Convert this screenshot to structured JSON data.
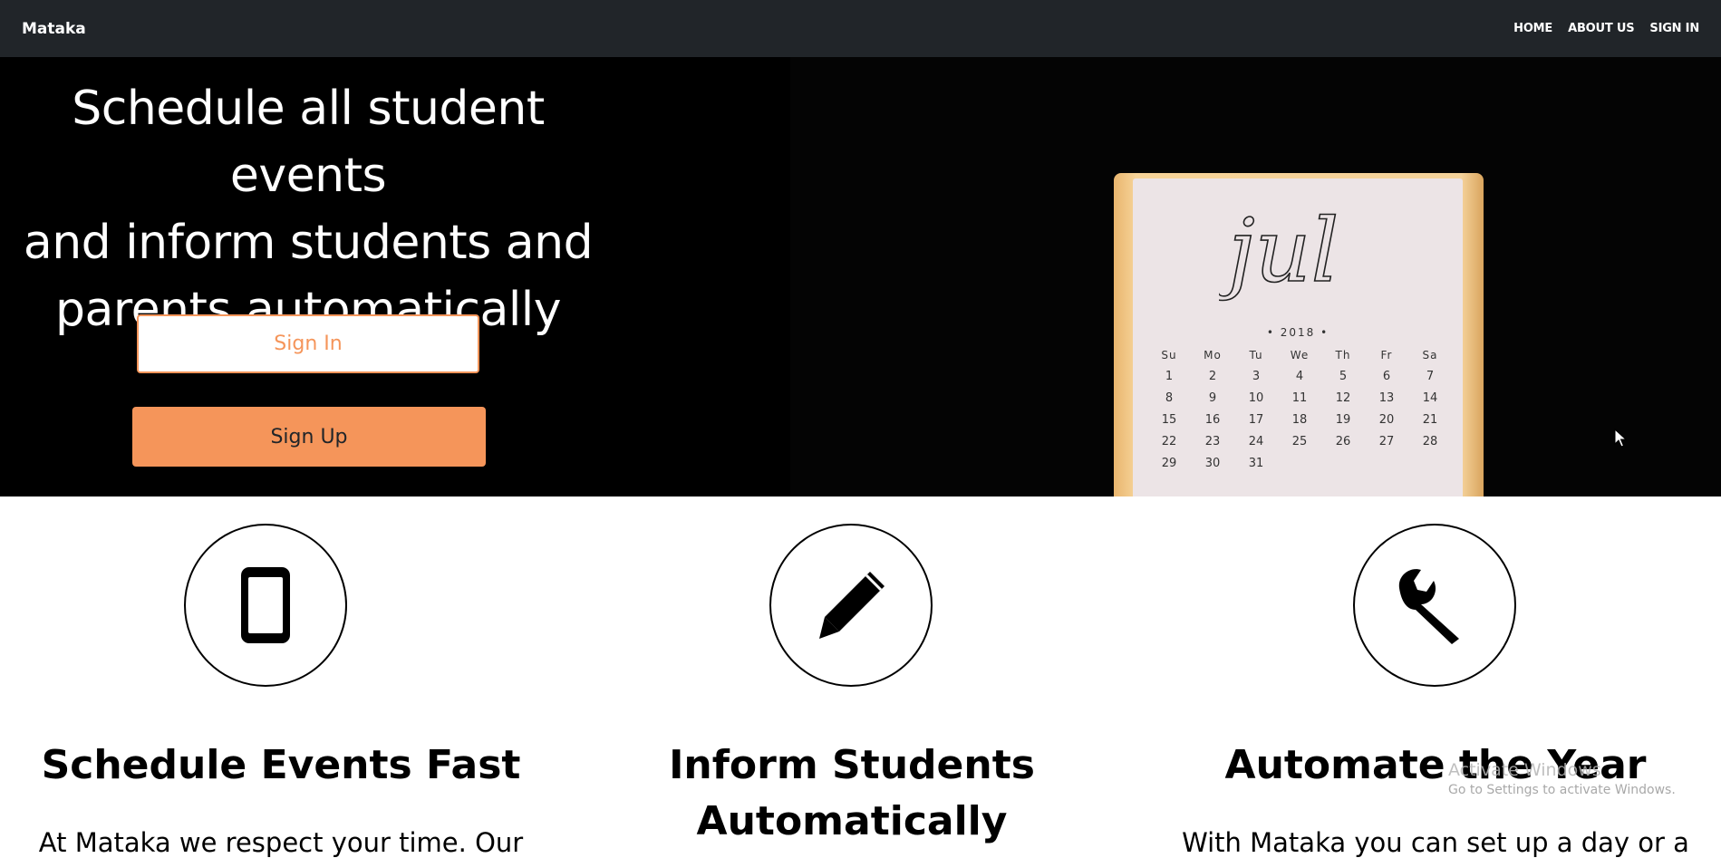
{
  "navbar": {
    "brand": "Mataka",
    "links": [
      "HOME",
      "ABOUT US",
      "SIGN IN"
    ]
  },
  "hero": {
    "title_lines": [
      "Schedule all student events",
      "and inform students and",
      "parents automatically"
    ],
    "signin_label": "Sign In",
    "signup_label": "Sign Up",
    "calendar": {
      "month": "jul",
      "year": "• 2018 •",
      "weekdays": [
        "Su",
        "Mo",
        "Tu",
        "We",
        "Th",
        "Fr",
        "Sa"
      ],
      "days": [
        "1",
        "2",
        "3",
        "4",
        "5",
        "6",
        "7",
        "8",
        "9",
        "10",
        "11",
        "12",
        "13",
        "14",
        "15",
        "16",
        "17",
        "18",
        "19",
        "20",
        "21",
        "22",
        "23",
        "24",
        "25",
        "26",
        "27",
        "28",
        "29",
        "30",
        "31"
      ]
    }
  },
  "features": [
    {
      "icon": "mobile-phone-icon",
      "title": "Schedule Events Fast",
      "text": "At Mataka we respect your time. Our"
    },
    {
      "icon": "pencil-icon",
      "title": "Inform Students Automatically",
      "text": ""
    },
    {
      "icon": "wrench-icon",
      "title": "Automate the Year",
      "text": "With Mataka you can set up a day or a"
    }
  ],
  "watermark": {
    "title": "Activate Windows",
    "subtitle": "Go to Settings to activate Windows."
  }
}
